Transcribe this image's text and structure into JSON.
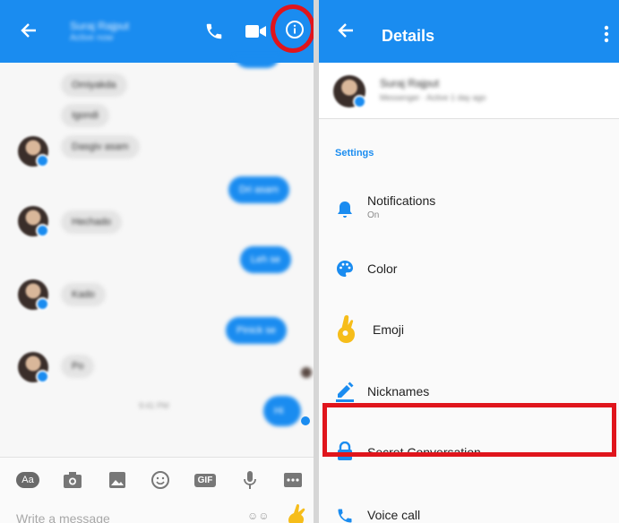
{
  "conversation": {
    "contact_name": "Suraj Rajput",
    "contact_status": "Active now",
    "composer_placeholder": "Write a message",
    "tools": [
      "Aa",
      "camera-icon",
      "image-icon",
      "emoji-icon",
      "GIF",
      "mic-icon",
      "more-icon"
    ],
    "messages": [
      {
        "dir": "in",
        "text": "Omiyakda"
      },
      {
        "dir": "in",
        "text": "Igondi"
      },
      {
        "dir": "in",
        "text": "Dasgiv asam",
        "avatar": true
      },
      {
        "dir": "out",
        "text": "Dri asam"
      },
      {
        "dir": "in",
        "text": "Hechado",
        "avatar": true
      },
      {
        "dir": "out",
        "text": "Leh se"
      },
      {
        "dir": "in",
        "text": "Kado",
        "avatar": true
      },
      {
        "dir": "out",
        "text": "Pinick se"
      },
      {
        "dir": "in",
        "text": "Po",
        "avatar": true
      },
      {
        "dir": "out",
        "text": "Hi"
      }
    ],
    "timestamp": "9:41 PM"
  },
  "details": {
    "title": "Details",
    "profile_name": "Suraj Rajput",
    "profile_sub": "Messenger · Active 1 day ago",
    "section_label": "Settings",
    "rows": [
      {
        "label": "Notifications",
        "sub": "On",
        "icon": "bell-icon"
      },
      {
        "label": "Color",
        "icon": "palette-icon"
      },
      {
        "label": "Emoji",
        "icon": "ok-hand-icon"
      },
      {
        "label": "Nicknames",
        "icon": "pencil-icon"
      },
      {
        "label": "Secret Conversation",
        "icon": "lock-icon"
      },
      {
        "label": "Voice call",
        "icon": "phone-icon"
      }
    ]
  },
  "colors": {
    "accent": "#1a8cf0",
    "highlight": "#e0151c"
  }
}
